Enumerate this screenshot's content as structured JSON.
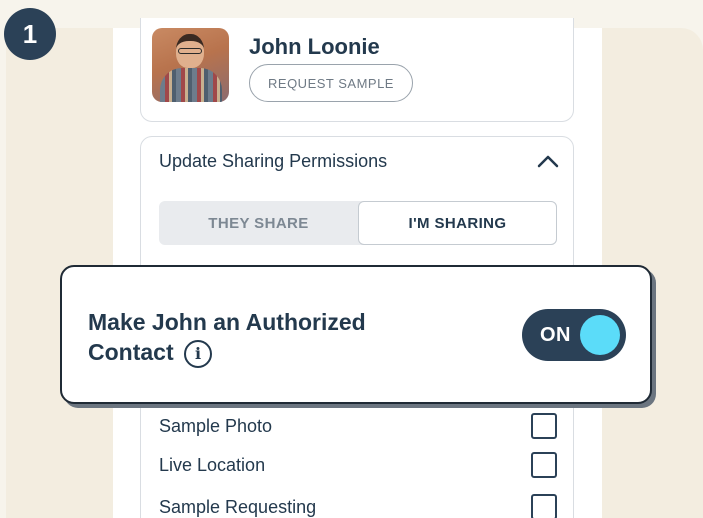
{
  "step": {
    "number": "1"
  },
  "profile": {
    "name": "John Loonie",
    "request_button": "REQUEST SAMPLE"
  },
  "permissions": {
    "title": "Update Sharing Permissions",
    "collapse_icon": "chevron-up-icon",
    "tabs": [
      {
        "label": "THEY SHARE",
        "selected": false
      },
      {
        "label": "I'M SHARING",
        "selected": true
      }
    ],
    "items": [
      {
        "label": "Sample Photo",
        "checked": false
      },
      {
        "label": "Live Location",
        "checked": false
      },
      {
        "label": "Sample Requesting",
        "checked": false
      }
    ]
  },
  "authorized": {
    "line1": "Make John an Authorized",
    "line2": "Contact",
    "info_icon": "info-icon",
    "toggle_label": "ON",
    "toggle_on": true
  },
  "colors": {
    "navy": "#2b4157",
    "accent": "#5bdcf9",
    "background": "#f3ede0"
  }
}
